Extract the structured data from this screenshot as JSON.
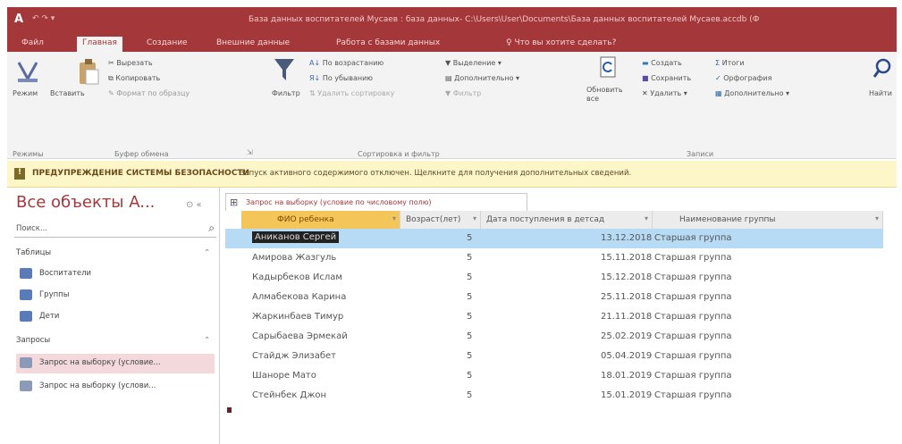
{
  "window": {
    "app_icon": "A",
    "qat": "↶ ↷ ▾",
    "title": "База данных воспитателей Мусаев : база данных- C:\\Users\\User\\Documents\\База данных воспитателей Мусаев.accdb (Ф"
  },
  "tabs": [
    {
      "label": "Файл"
    },
    {
      "label": "Главная"
    },
    {
      "label": "Создание"
    },
    {
      "label": "Внешние данные"
    },
    {
      "label": "Работа с базами данных"
    },
    {
      "label": "♀ Что вы хотите сделать?"
    }
  ],
  "ribbon": {
    "views": {
      "mode": "Режим",
      "group": "Режимы"
    },
    "clipboard": {
      "paste": "Вставить",
      "cut": "Вырезать",
      "copy": "Копировать",
      "format_painter": "Формат по образцу",
      "group": "Буфер обмена"
    },
    "sort": {
      "filter": "Фильтр",
      "ascending": "По возрастанию",
      "descending": "По убыванию",
      "remove_sort": "Удалить сортировку",
      "selection": "Выделение",
      "advanced": "Дополнительно",
      "toggle_filter": "Фильтр",
      "group": "Сортировка и фильтр"
    },
    "records": {
      "refresh": "Обновить все",
      "new": "Создать",
      "save": "Сохранить",
      "delete": "Удалить",
      "totals": "Итоги",
      "spelling": "Орфография",
      "more": "Дополнительно",
      "group": "Записи"
    },
    "find": {
      "label": "Найти"
    }
  },
  "security": {
    "heading": "ПРЕДУПРЕЖДЕНИЕ СИСТЕМЫ БЕЗОПАСНОСТИ",
    "message": "Запуск активного содержимого отключен. Щелкните для получения дополнительных сведений."
  },
  "nav": {
    "title": "Все объекты A...",
    "search_placeholder": "Поиск...",
    "tables_header": "Таблицы",
    "tables": [
      {
        "label": "Воспитатели"
      },
      {
        "label": "Группы"
      },
      {
        "label": "Дети"
      }
    ],
    "queries_header": "Запросы",
    "queries": [
      {
        "label": "Запрос на выборку (условие..."
      },
      {
        "label": "Запрос на выборку (услови..."
      }
    ]
  },
  "document": {
    "tab_label": "Запрос на выборку (условие по числовому полю)",
    "columns": [
      "ФИО ребенка",
      "Возраст(лет)",
      "Дата поступления в детсад",
      "Наименование группы"
    ],
    "rows": [
      [
        "Аниканов Сергей",
        "5",
        "13.12.2018",
        "Старшая группа"
      ],
      [
        "Амирова Жазгуль",
        "5",
        "15.11.2018",
        "Старшая группа"
      ],
      [
        "Кадырбеков Ислам",
        "5",
        "15.12.2018",
        "Старшая группа"
      ],
      [
        "Алмабекова Карина",
        "5",
        "25.11.2018",
        "Старшая группа"
      ],
      [
        "Жаркинбаев Тимур",
        "5",
        "21.11.2018",
        "Старшая группа"
      ],
      [
        "Сарыбаева Эрмекай",
        "5",
        "25.02.2019",
        "Старшая группа"
      ],
      [
        "Стайдж Элизабет",
        "5",
        "05.04.2019",
        "Старшая группа"
      ],
      [
        "Шаноре Мато",
        "5",
        "18.01.2019",
        "Старшая группа"
      ],
      [
        "Стейнбек Джон",
        "5",
        "15.01.2019",
        "Старшая группа"
      ]
    ]
  },
  "colors": {
    "access_brand": "#a4373a",
    "security_bar": "#fdf6c8",
    "selected_header": "#f4c65a",
    "selected_row": "#b8dbf5"
  }
}
